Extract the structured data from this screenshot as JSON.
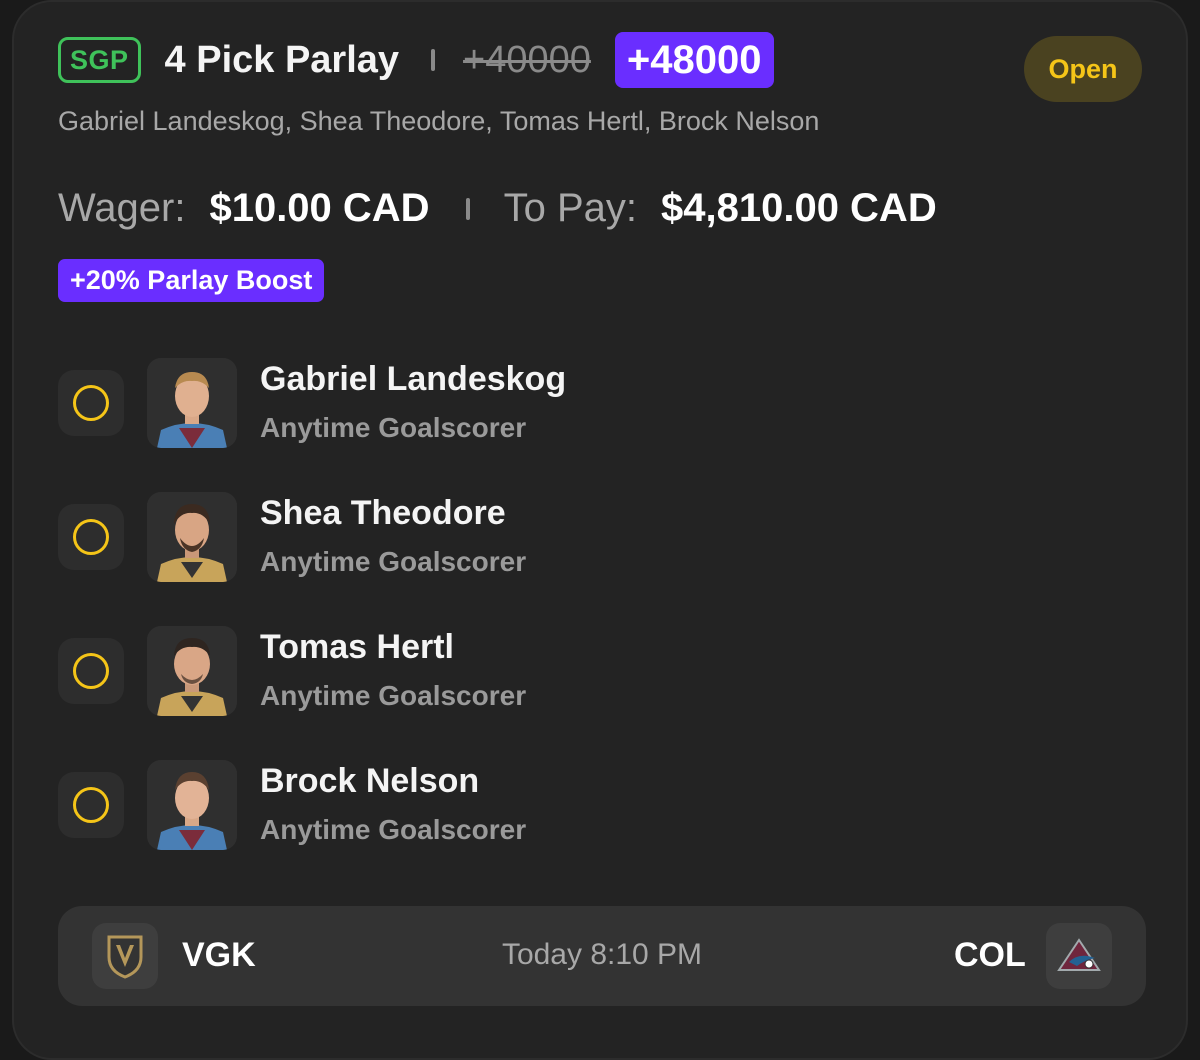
{
  "bet": {
    "tag": "SGP",
    "title": "4 Pick Parlay",
    "original_odds": "+40000",
    "boosted_odds": "+48000",
    "status": "Open",
    "players_summary": "Gabriel Landeskog, Shea Theodore, Tomas Hertl, Brock Nelson",
    "wager_label": "Wager:",
    "wager_value": "$10.00 CAD",
    "to_pay_label": "To Pay:",
    "to_pay_value": "$4,810.00 CAD",
    "boost_label": "+20% Parlay Boost"
  },
  "legs": [
    {
      "name": "Gabriel Landeskog",
      "market": "Anytime Goalscorer",
      "jersey": "avalanche"
    },
    {
      "name": "Shea Theodore",
      "market": "Anytime Goalscorer",
      "jersey": "golden-knights"
    },
    {
      "name": "Tomas Hertl",
      "market": "Anytime Goalscorer",
      "jersey": "golden-knights"
    },
    {
      "name": "Brock Nelson",
      "market": "Anytime Goalscorer",
      "jersey": "avalanche"
    }
  ],
  "game": {
    "away_team": "VGK",
    "home_team": "COL",
    "time": "Today 8:10 PM",
    "away_logo": "golden-knights-shield-icon",
    "home_logo": "avalanche-a-icon"
  },
  "colors": {
    "accent_purple": "#6a2eff",
    "sgp_green": "#3fc25a",
    "status_yellow": "#f5c518",
    "card_bg": "#232323"
  }
}
